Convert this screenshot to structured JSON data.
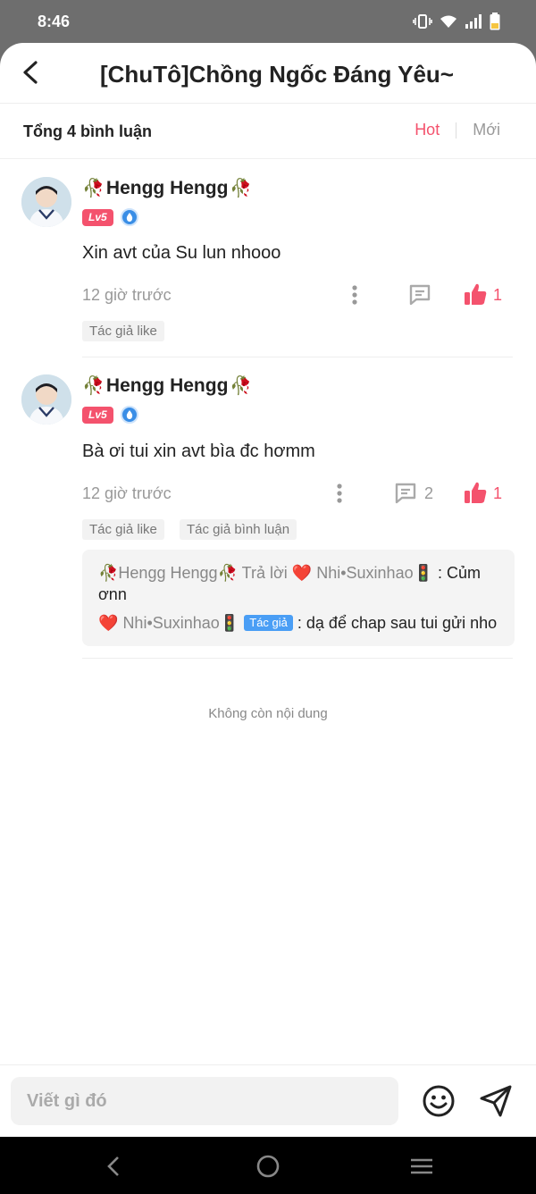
{
  "status_bar": {
    "time": "8:46"
  },
  "header": {
    "title": "[ChuTô]Chồng Ngốc Đáng Yêu~"
  },
  "summary": {
    "count_label": "Tổng 4 bình luận",
    "tabs": [
      "Hot",
      "Mới"
    ],
    "active_tab": "Hot"
  },
  "comments": [
    {
      "username": "Hengg Hengg",
      "level": "Lv5",
      "text": "Xin avt của Su lun nhooo",
      "time": "12 giờ trước",
      "reply_count": "",
      "like_count": "1",
      "tags": [
        "Tác giả like"
      ]
    },
    {
      "username": "Hengg Hengg",
      "level": "Lv5",
      "text": "Bà ơi tui xin avt bìa đc hơmm",
      "time": "12 giờ trước",
      "reply_count": "2",
      "like_count": "1",
      "tags": [
        "Tác giả like",
        "Tác giả bình luận"
      ],
      "replies": [
        {
          "from": "Hengg Hengg",
          "verb": "Trả lời",
          "to": "Nhi•Suxinhao",
          "text": ": Củm ơnn"
        },
        {
          "from": "Nhi•Suxinhao",
          "author_tag": "Tác giả",
          "text": ": dạ để chap sau tui gửi nho"
        }
      ]
    }
  ],
  "end_text": "Không còn nội dung",
  "composer": {
    "placeholder": "Viết gì đó"
  },
  "colors": {
    "accent": "#f4526d",
    "author_blue": "#4a9ef5",
    "muted": "#999999"
  },
  "icons": [
    "back-arrow-icon",
    "rose-icon",
    "drop-icon",
    "more-icon",
    "comment-icon",
    "thumbs-up-icon",
    "heart-icon",
    "traffic-light-icon",
    "emoji-icon",
    "send-icon",
    "nav-back-icon",
    "nav-home-icon",
    "nav-menu-icon"
  ]
}
